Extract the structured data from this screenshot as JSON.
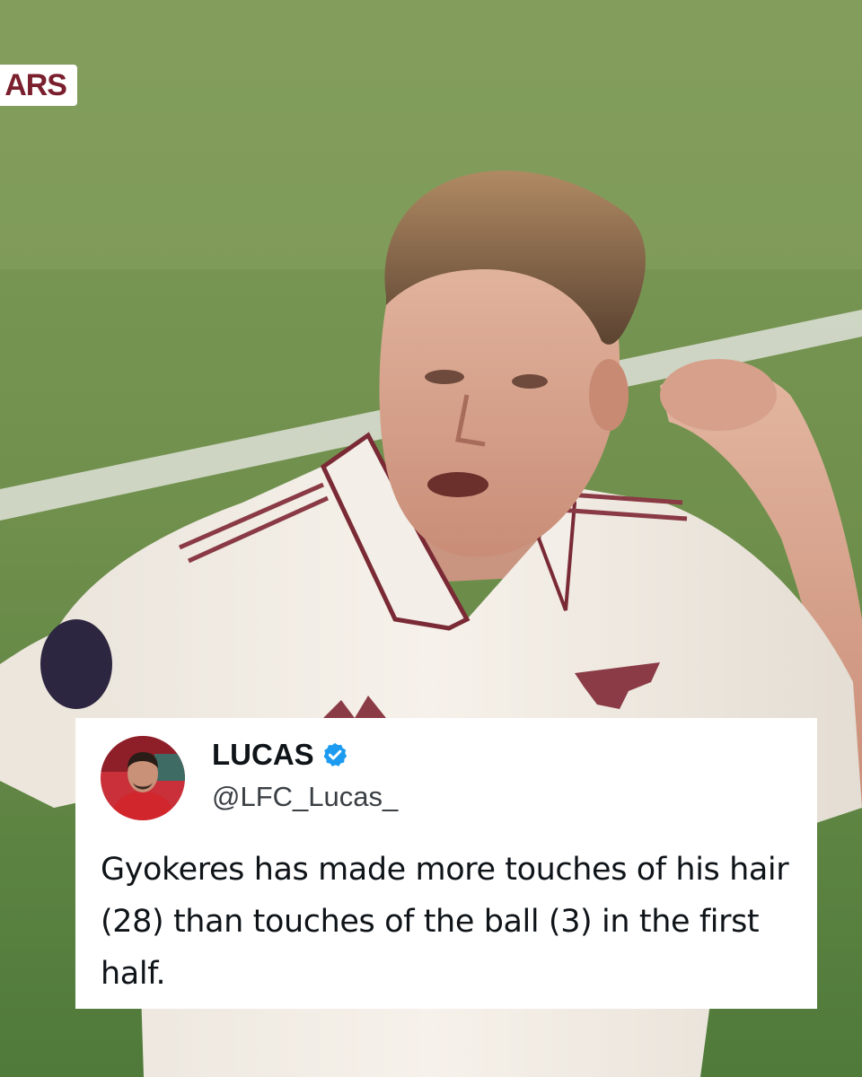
{
  "broadcast": {
    "score_tag_text": "ARS",
    "score_tag_color": "#7a1f2e"
  },
  "tweet": {
    "display_name": "LUCAS",
    "verified": true,
    "verified_color": "#1d9bf0",
    "handle": "@LFC_Lucas_",
    "text": "Gyokeres has made more touches of his hair (28) than touches of the ball (3) in the first half.",
    "avatar_icon": "profile-photo"
  }
}
